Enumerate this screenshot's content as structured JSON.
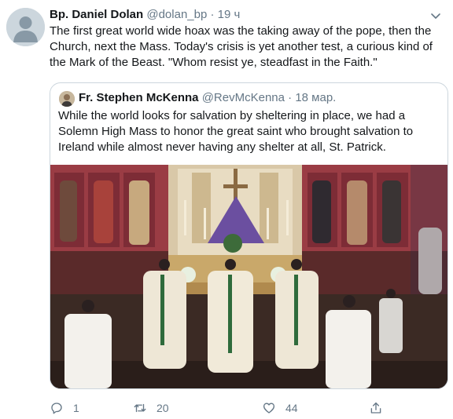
{
  "tweet": {
    "author_name": "Bp. Daniel Dolan",
    "author_handle": "@dolan_bp",
    "separator": "·",
    "time": "19 ч",
    "text": "The first great world wide hoax was the taking away of the pope, then the Church, next the Mass. Today's crisis is yet another test, a curious kind of the Mark of the Beast. \"Whom resist ye, steadfast in the Faith.\""
  },
  "quoted_tweet": {
    "author_name": "Fr. Stephen McKenna",
    "author_handle": "@RevMcKenna",
    "separator": "·",
    "time": "18 мар.",
    "text": "While the world looks for salvation by sheltering in place, we had a Solemn High Mass to honor the great saint who brought salvation to Ireland while almost never having any shelter at all, St. Patrick."
  },
  "actions": {
    "reply_count": "1",
    "retweet_count": "20",
    "like_count": "44"
  },
  "icons": {
    "reply": "reply-icon",
    "retweet": "retweet-icon",
    "like": "heart-icon",
    "share": "share-icon",
    "menu": "chevron-down-icon"
  },
  "colors": {
    "text_primary": "#14171a",
    "text_secondary": "#657786",
    "border": "#ccd6dd",
    "photo_wall": "#a0444a",
    "photo_gold": "#c9a86a",
    "altar_purple": "#6b4fa0"
  }
}
